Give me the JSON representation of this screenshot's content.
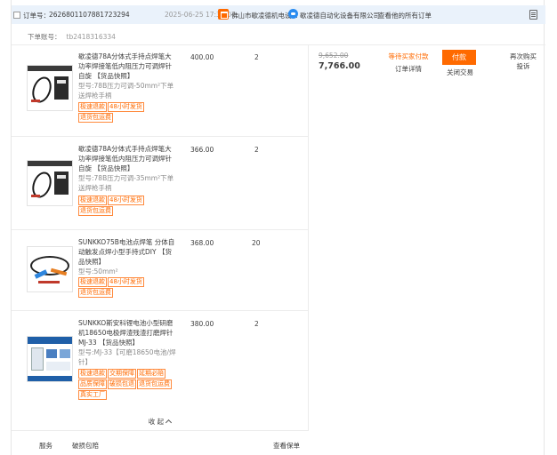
{
  "order": {
    "label": "订单号：",
    "number": "2626801107881723294",
    "date": "2025-06-25 17:30:07",
    "shop_name": "佛山市歇凌德机电设...",
    "wangwang_name": "歇凌德自动化设备有限公司",
    "all_orders_link": "查看他的所有订单",
    "orderer_label": "下单账号：",
    "orderer_value": "tb2418316334"
  },
  "payment": {
    "original_price": "9,652.00",
    "total": "7,766.00"
  },
  "status": {
    "text": "等待买家付款",
    "detail_link": "订单详情"
  },
  "actions": {
    "pay_button": "付款",
    "close_link": "关闭交易",
    "buy_again": "再次购买",
    "complain": "投诉"
  },
  "items": [
    {
      "title": "歇凌德78A分体式手持点焊笔大功率焊接笔低内阻压力可调焊针自旋 【货品快照】",
      "spec": "型号:78B压力可调-50mm²下单送焊枪手柄",
      "tags": [
        "极速退款",
        "48小时发货",
        "退货包运费"
      ],
      "price": "400.00",
      "qty": "2"
    },
    {
      "title": "歇凌德78A分体式手持点焊笔大功率焊接笔低内阻压力可调焊针自旋 【货品快照】",
      "spec": "型号:78B压力可调-35mm²下单送焊枪手柄",
      "tags": [
        "极速退款",
        "48小时发货",
        "退货包运费"
      ],
      "price": "366.00",
      "qty": "2"
    },
    {
      "title": "SUNKKO75B电池点焊笔 分体自动触发点焊小型手持式DIY 【货品快照】",
      "spec": "型号:50mm²",
      "tags": [
        "极速退款",
        "48小时发货",
        "退货包运费"
      ],
      "price": "368.00",
      "qty": "20"
    },
    {
      "title": "SUNKKO斯安科锂电池小型研磨机18650电极焊渣残渣打磨焊针MJ-33 【货品快照】",
      "spec": "型号:MJ-33【可磨18650电池/焊针】",
      "tags": [
        "极速退款",
        "交期保障",
        "延期必赔",
        "品质保障",
        "破损包退",
        "退货包运费",
        "真实工厂"
      ],
      "price": "380.00",
      "qty": "2"
    }
  ],
  "collapse_label": "收 起",
  "services": {
    "label": "服务",
    "damage": "破损包赔",
    "view_policy": "查看保单"
  },
  "colors": {
    "accent": "#ff6a00",
    "header_bg": "#eaf2fb",
    "wangwang": "#2a8cf0"
  }
}
